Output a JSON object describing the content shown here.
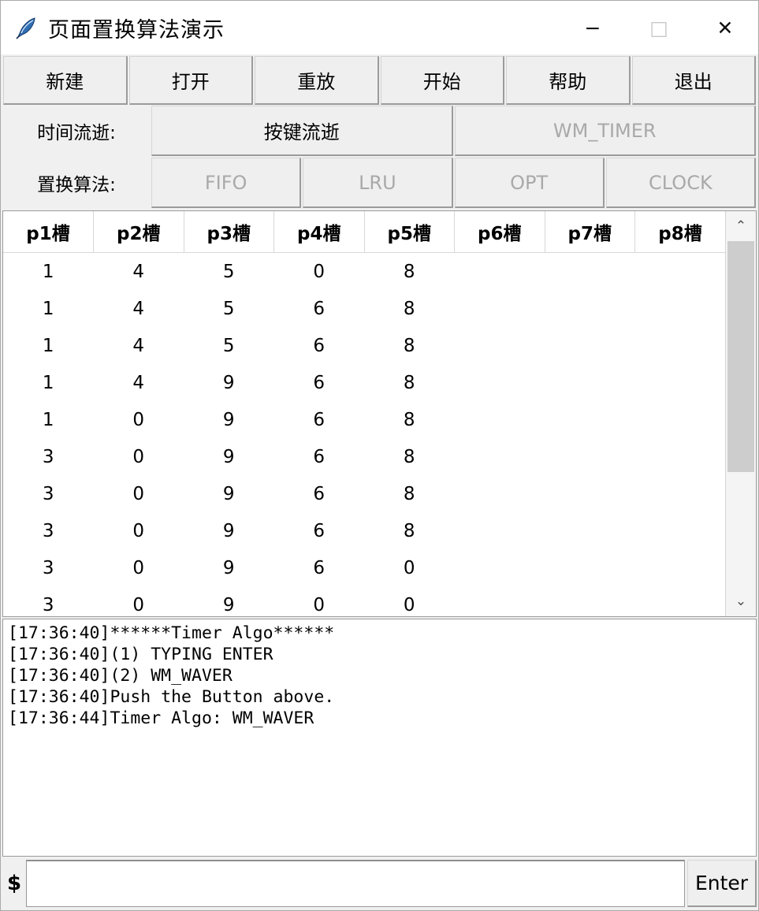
{
  "window": {
    "title": "页面置换算法演示",
    "icon": "feather-quill-icon",
    "controls": {
      "minimize": "−",
      "maximize": "□",
      "close": "✕",
      "maximize_disabled": true
    }
  },
  "toolbar": {
    "buttons": [
      {
        "label": "新建",
        "name": "new-button"
      },
      {
        "label": "打开",
        "name": "open-button"
      },
      {
        "label": "重放",
        "name": "replay-button"
      },
      {
        "label": "开始",
        "name": "start-button"
      },
      {
        "label": "帮助",
        "name": "help-button"
      },
      {
        "label": "退出",
        "name": "exit-button"
      }
    ]
  },
  "time_mode": {
    "label": "时间流逝:",
    "options": [
      {
        "label": "按键流逝",
        "name": "time-mode-keypress",
        "disabled": false
      },
      {
        "label": "WM_TIMER",
        "name": "time-mode-wm-timer",
        "disabled": true
      }
    ]
  },
  "algorithm": {
    "label": "置换算法:",
    "options": [
      {
        "label": "FIFO",
        "name": "algo-fifo",
        "disabled": true
      },
      {
        "label": "LRU",
        "name": "algo-lru",
        "disabled": true
      },
      {
        "label": "OPT",
        "name": "algo-opt",
        "disabled": true
      },
      {
        "label": "CLOCK",
        "name": "algo-clock",
        "disabled": true
      }
    ]
  },
  "table": {
    "headers": [
      "p1槽",
      "p2槽",
      "p3槽",
      "p4槽",
      "p5槽",
      "p6槽",
      "p7槽",
      "p8槽"
    ],
    "rows": [
      [
        "1",
        "4",
        "5",
        "0",
        "8",
        "",
        "",
        ""
      ],
      [
        "1",
        "4",
        "5",
        "6",
        "8",
        "",
        "",
        ""
      ],
      [
        "1",
        "4",
        "5",
        "6",
        "8",
        "",
        "",
        ""
      ],
      [
        "1",
        "4",
        "9",
        "6",
        "8",
        "",
        "",
        ""
      ],
      [
        "1",
        "0",
        "9",
        "6",
        "8",
        "",
        "",
        ""
      ],
      [
        "3",
        "0",
        "9",
        "6",
        "8",
        "",
        "",
        ""
      ],
      [
        "3",
        "0",
        "9",
        "6",
        "8",
        "",
        "",
        ""
      ],
      [
        "3",
        "0",
        "9",
        "6",
        "8",
        "",
        "",
        ""
      ],
      [
        "3",
        "0",
        "9",
        "6",
        "0",
        "",
        "",
        ""
      ],
      [
        "3",
        "0",
        "9",
        "0",
        "0",
        "",
        "",
        ""
      ]
    ],
    "scrollbar": {
      "up_arrow": "⌃",
      "down_arrow": "⌄"
    }
  },
  "log": {
    "lines": [
      "[17:36:40]******Timer Algo******",
      "[17:36:40](1) TYPING ENTER",
      "[17:36:40](2) WM_WAVER",
      "[17:36:40]Push the Button above.",
      "[17:36:44]Timer Algo: WM_WAVER"
    ]
  },
  "command_bar": {
    "prompt": "$",
    "input_value": "",
    "input_placeholder": "",
    "enter_label": "Enter"
  }
}
